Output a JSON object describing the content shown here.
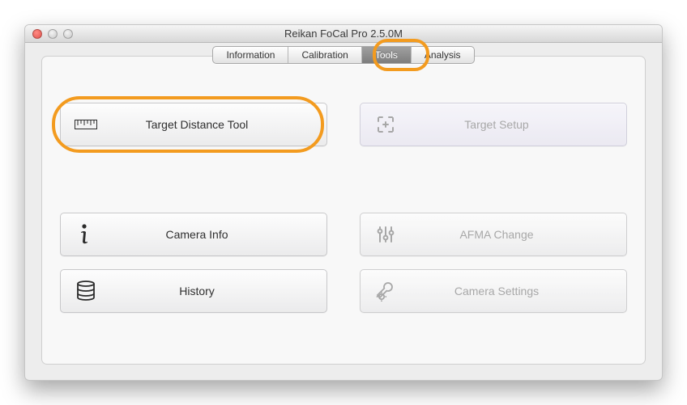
{
  "window": {
    "title": "Reikan FoCal Pro 2.5.0M"
  },
  "tabs": [
    {
      "label": "Information",
      "active": false
    },
    {
      "label": "Calibration",
      "active": false
    },
    {
      "label": "Tools",
      "active": true
    },
    {
      "label": "Analysis",
      "active": false
    }
  ],
  "tools": {
    "target_distance": "Target Distance Tool",
    "target_setup": "Target Setup",
    "camera_info": "Camera Info",
    "afma_change": "AFMA Change",
    "history": "History",
    "camera_settings": "Camera Settings"
  },
  "accent_color": "#f39b1f"
}
